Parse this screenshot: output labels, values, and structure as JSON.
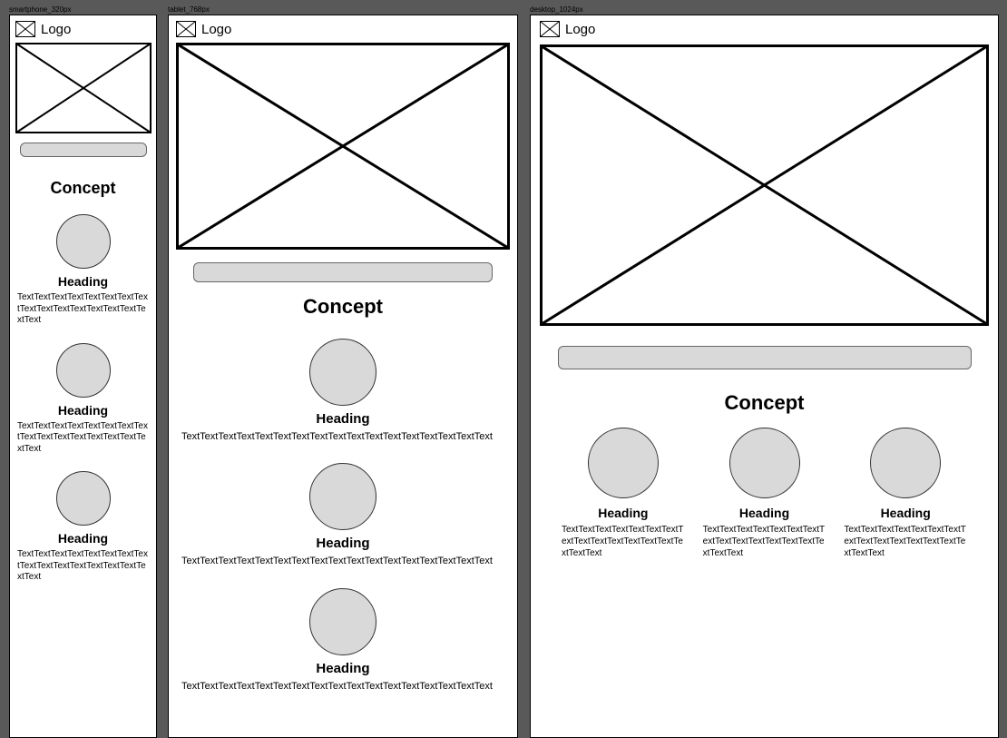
{
  "labels": {
    "smartphone": "smartphone_320px",
    "tablet": "tablet_768px",
    "desktop": "desktop_1024px"
  },
  "common": {
    "logo_text": "Logo",
    "concept": "Concept",
    "heading": "Heading"
  },
  "smartphone": {
    "body_text": "TextTextTextTextTextTextTextTextTextTextTextTextTextTextTextTextText"
  },
  "tablet": {
    "body_text": "TextTextTextTextTextTextTextTextTextTextTextTextTextTextTextTextText"
  },
  "desktop": {
    "body_text": "TextTextTextTextTextTextTextTextTextTextTextTextTextTextTextTextText"
  }
}
